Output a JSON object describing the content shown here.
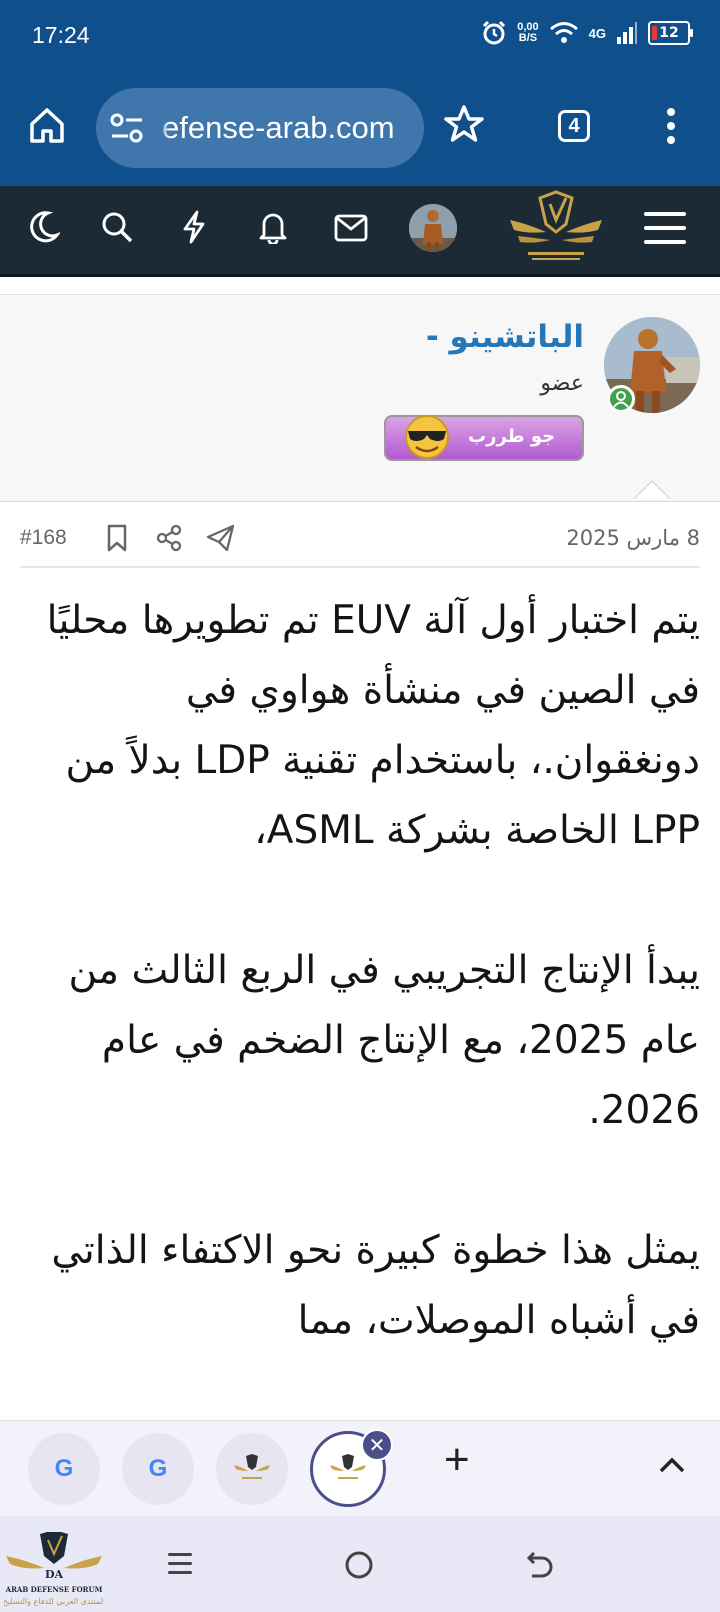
{
  "status_bar": {
    "time": "17:24",
    "net_speed_value": "0,00",
    "net_speed_unit": "B/S",
    "network": "4G",
    "battery": "12",
    "battery_color": "#e53935",
    "icons": [
      "alarm-icon",
      "wifi-icon",
      "signal-icon",
      "battery-icon"
    ]
  },
  "browser": {
    "url": "efense-arab.com",
    "tab_count": "4",
    "icons": [
      "home-icon",
      "site-settings-icon",
      "star-icon",
      "tab-switcher-icon",
      "more-menu-icon"
    ],
    "toolbar_color": "#0f4f8c"
  },
  "forum_nav": {
    "icons": [
      "moon-icon",
      "search-icon",
      "bolt-icon",
      "bell-icon",
      "mail-icon",
      "user-avatar",
      "forum-logo",
      "hamburger-menu-icon"
    ]
  },
  "post": {
    "author": {
      "name": "الباتشينو -",
      "title": "عضو",
      "banner_text": "جو طررب",
      "status": "online"
    },
    "date": "8 مارس 2025",
    "number": "#168",
    "actions": [
      "bookmark-icon",
      "share-icon",
      "telegram-icon"
    ],
    "paragraphs": [
      "يتم اختبار أول آلة EUV تم تطويرها محليًا في الصين في منشأة هواوي في دونغقوان.، باستخدام تقنية LDP بدلاً من LPP الخاصة بشركة ASML،",
      "يبدأ الإنتاج التجريبي في الربع الثالث من عام 2025، مع الإنتاج الضخم في عام 2026.",
      "يمثل هذا خطوة كبيرة نحو الاكتفاء الذاتي في أشباه الموصلات، مما"
    ]
  },
  "tab_strip": {
    "tabs": [
      "google-tab",
      "google-tab",
      "forum-tab",
      "forum-tab-active"
    ],
    "google_letter": "G",
    "new_tab_label": "+",
    "close_label": "✕"
  },
  "watermark": {
    "line1": "ARAB DEFENSE FORUM",
    "line2": "المنتدى العربي للدفاع والتسليح"
  }
}
